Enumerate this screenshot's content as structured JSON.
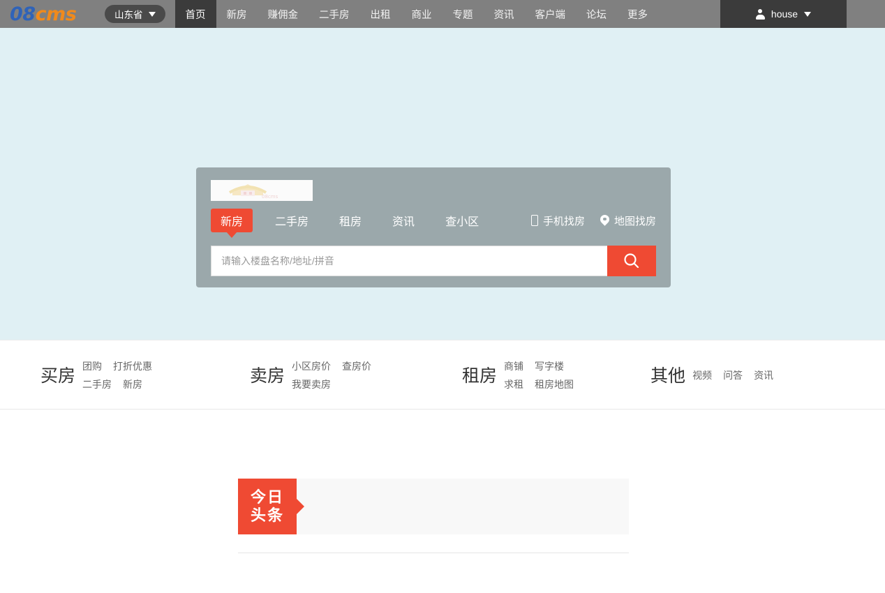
{
  "topbar": {
    "logo": {
      "part1": "08",
      "part2": "cms"
    },
    "city_selector": {
      "label": "山东省",
      "icon": "chevron-down-icon"
    },
    "nav_items": [
      {
        "label": "首页",
        "active": true
      },
      {
        "label": "新房",
        "active": false
      },
      {
        "label": "赚佣金",
        "active": false
      },
      {
        "label": "二手房",
        "active": false
      },
      {
        "label": "出租",
        "active": false
      },
      {
        "label": "商业",
        "active": false
      },
      {
        "label": "专题",
        "active": false
      },
      {
        "label": "资讯",
        "active": false
      },
      {
        "label": "客户端",
        "active": false
      },
      {
        "label": "论坛",
        "active": false
      },
      {
        "label": "更多",
        "active": false
      }
    ],
    "user": {
      "name": "house",
      "icon": "user-icon",
      "caret": "chevron-down-icon"
    }
  },
  "hero": {
    "background_color": "#e0f0f4",
    "panel_color": "#9ba8ab",
    "accent_color": "#ef4a33",
    "tabs": [
      {
        "label": "新房",
        "active": true
      },
      {
        "label": "二手房",
        "active": false
      },
      {
        "label": "租房",
        "active": false
      },
      {
        "label": "资讯",
        "active": false
      },
      {
        "label": "查小区",
        "active": false
      }
    ],
    "shortcuts": [
      {
        "label": "手机找房",
        "icon": "phone-icon"
      },
      {
        "label": "地图找房",
        "icon": "map-pin-icon"
      }
    ],
    "search": {
      "placeholder": "请输入楼盘名称/地址/拼音",
      "value": "",
      "button_icon": "search-icon"
    }
  },
  "quicklinks": [
    {
      "title": "买房",
      "rows": [
        [
          "团购",
          "打折优惠"
        ],
        [
          "二手房",
          "新房"
        ]
      ]
    },
    {
      "title": "卖房",
      "rows": [
        [
          "小区房价",
          "查房价"
        ],
        [
          "我要卖房"
        ]
      ]
    },
    {
      "title": "租房",
      "rows": [
        [
          "商铺",
          "写字楼"
        ],
        [
          "求租",
          "租房地图"
        ]
      ]
    },
    {
      "title": "其他",
      "rows": [
        [
          "视频",
          "问答",
          "资讯"
        ]
      ]
    }
  ],
  "headline": {
    "badge_line1": "今日",
    "badge_line2": "头条",
    "badge_color": "#ef4a33",
    "body_text": ""
  }
}
